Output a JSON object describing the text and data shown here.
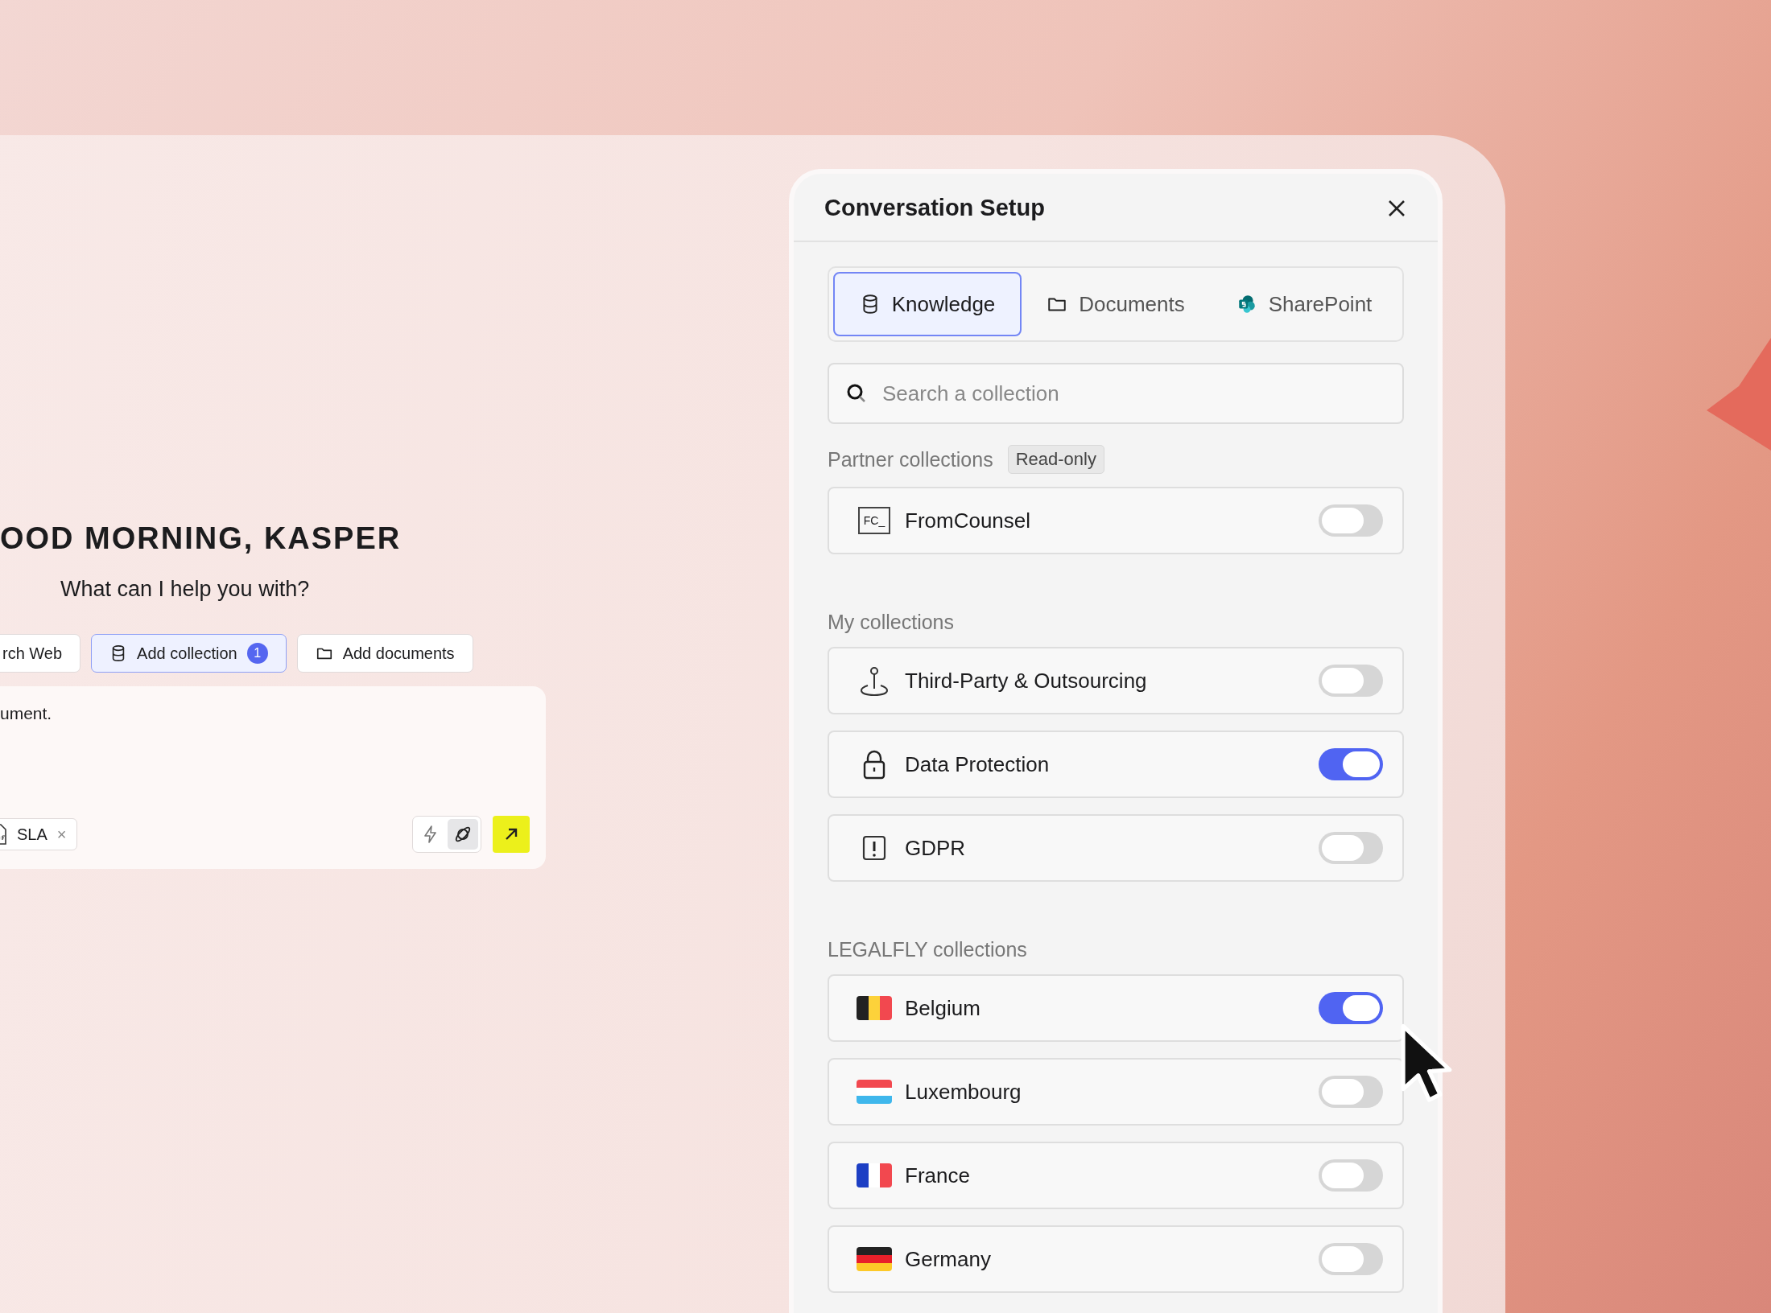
{
  "home": {
    "greeting": "OOD MORNING, KASPER",
    "prompt": "What can I help you with?",
    "actions": [
      {
        "label": "rch Web",
        "selected": false
      },
      {
        "label": "Add collection",
        "selected": true,
        "badge": "1"
      },
      {
        "label": "Add documents",
        "selected": false
      }
    ],
    "composer": {
      "value": "ument.",
      "attachment": {
        "label": "SLA",
        "remove": "×"
      },
      "modes": [
        {
          "selected": false
        },
        {
          "selected": true
        }
      ]
    }
  },
  "panel": {
    "title": "Conversation Setup",
    "tabs": [
      {
        "label": "Knowledge",
        "selected": true
      },
      {
        "label": "Documents",
        "selected": false
      },
      {
        "label": "SharePoint",
        "selected": false
      }
    ],
    "search": {
      "placeholder": "Search a collection"
    },
    "sections": [
      {
        "title": "Partner collections",
        "tag": "Read-only",
        "items": [
          {
            "name": "FromCounsel",
            "kind": "logo",
            "logo_text": "FC_",
            "on": false
          }
        ]
      },
      {
        "title": "My collections",
        "items": [
          {
            "name": "Third-Party & Outsourcing",
            "kind": "pin",
            "on": false
          },
          {
            "name": "Data Protection",
            "kind": "lock",
            "on": true
          },
          {
            "name": "GDPR",
            "kind": "alert",
            "on": false
          }
        ]
      },
      {
        "title": "LEGALFLY collections",
        "items": [
          {
            "name": "Belgium",
            "kind": "flag",
            "on": true
          },
          {
            "name": "Luxembourg",
            "kind": "flag",
            "on": false
          },
          {
            "name": "France",
            "kind": "flag",
            "on": false
          },
          {
            "name": "Germany",
            "kind": "flag",
            "on": false
          }
        ]
      }
    ]
  }
}
